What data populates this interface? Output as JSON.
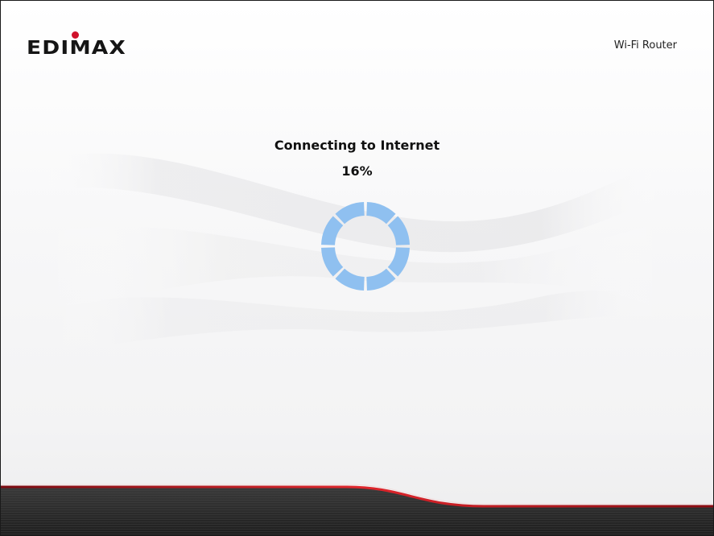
{
  "header": {
    "brand": "EDIMAX",
    "product": "Wi-Fi Router"
  },
  "status": {
    "title": "Connecting to Internet",
    "percent_label": "16%",
    "progress_fraction": 0.16
  },
  "colors": {
    "spinner": "#8fc0f0",
    "brand_red": "#d0112b",
    "footer_dark": "#2b2b2b",
    "accent_red": "#c4121c"
  },
  "icons": {
    "spinner": "loading-spinner-icon"
  }
}
